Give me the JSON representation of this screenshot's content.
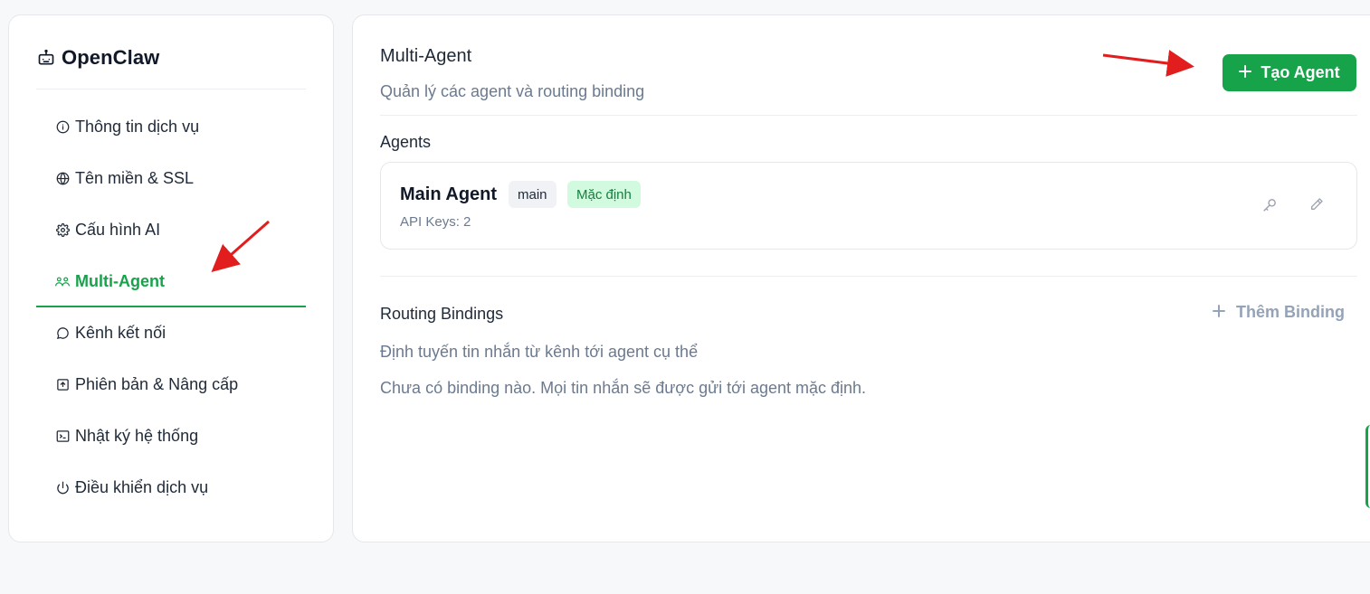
{
  "brand": {
    "name": "OpenClaw",
    "icon": "robot-icon"
  },
  "sidebar": {
    "items": [
      {
        "label": "Thông tin dịch vụ",
        "icon": "info-icon"
      },
      {
        "label": "Tên miền & SSL",
        "icon": "globe-icon"
      },
      {
        "label": "Cấu hình AI",
        "icon": "gear-icon"
      },
      {
        "label": "Multi-Agent",
        "icon": "users-icon",
        "active": true
      },
      {
        "label": "Kênh kết nối",
        "icon": "chat-bubble-icon"
      },
      {
        "label": "Phiên bản & Nâng cấp",
        "icon": "upgrade-icon"
      },
      {
        "label": "Nhật ký hệ thống",
        "icon": "terminal-icon"
      },
      {
        "label": "Điều khiển dịch vụ",
        "icon": "power-icon"
      }
    ]
  },
  "main": {
    "title": "Multi-Agent",
    "subtitle": "Quản lý các agent và routing binding",
    "create_button": "Tạo Agent",
    "agents_label": "Agents",
    "agents": [
      {
        "name": "Main Agent",
        "badge_id": "main",
        "badge_default": "Mặc định",
        "api_keys": "API Keys: 2"
      }
    ],
    "routing": {
      "label": "Routing Bindings",
      "add_button": "Thêm Binding",
      "description": "Định tuyến tin nhắn từ kênh tới agent cụ thể",
      "empty": "Chưa có binding nào. Mọi tin nhắn sẽ được gửi tới agent mặc định."
    }
  },
  "colors": {
    "accent": "#16a34a",
    "annotation_arrow": "#e11d1d"
  }
}
